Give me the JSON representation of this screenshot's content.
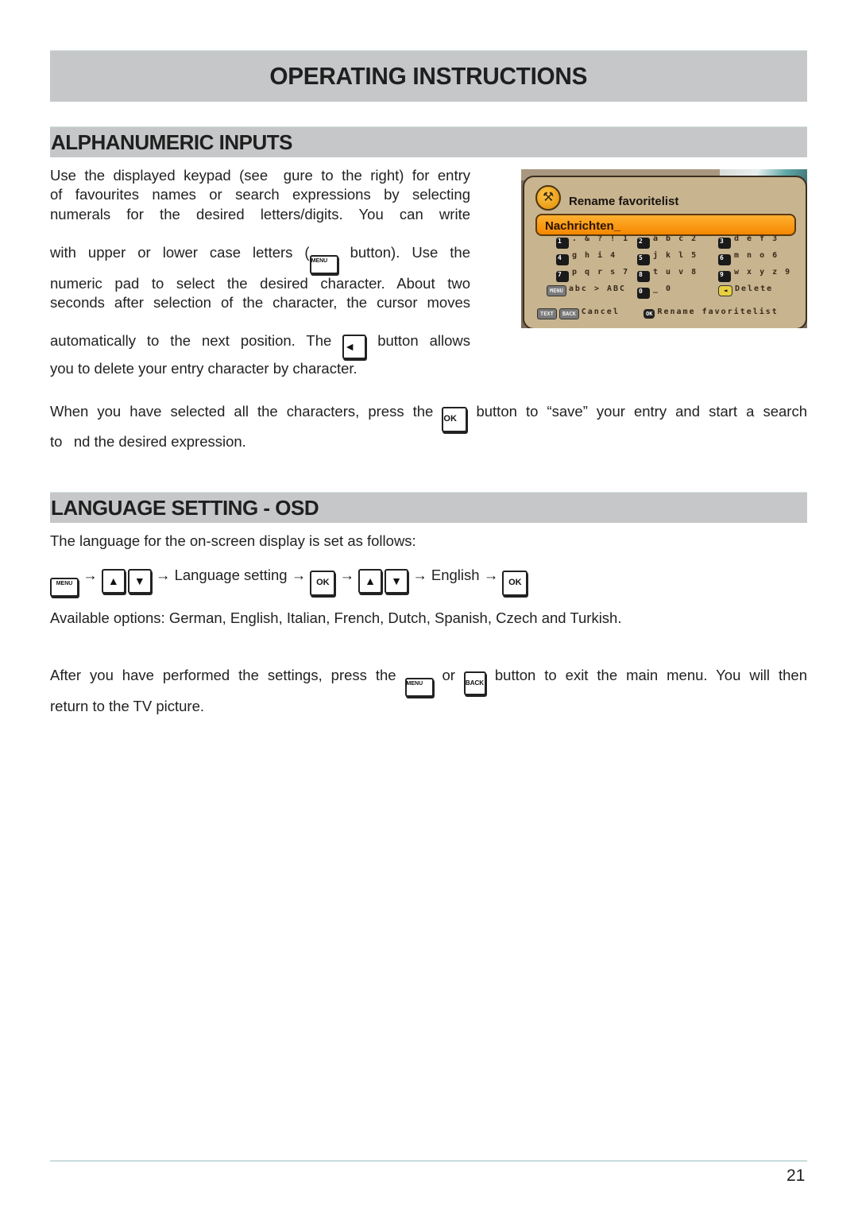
{
  "header": {
    "title": "OPERATING INSTRUCTIONS"
  },
  "sections": {
    "alphanumeric": {
      "title": "ALPHANUMERIC INPUTS",
      "para1": {
        "l1": "Use the displayed keypad (see  gure to the right) for entry",
        "l2": "of favourites names or search expressions by selecting",
        "l3": "numerals for the desired letters/digits. You can write",
        "l4a": "with upper or lower case letters (",
        "l4b": " button). Use the",
        "l5": "numeric pad to select the desired character. About two",
        "l6": "seconds after selection of the character, the cursor moves",
        "l7a": "automatically to the next position. The ",
        "l7b": " button allows",
        "l8": "you to delete your entry character by character."
      },
      "para2": {
        "l1a": "When you have selected all the characters, press the ",
        "l1b": " button to “save” your entry and start a search",
        "l2": "to  nd the desired expression."
      }
    },
    "language": {
      "title": "LANGUAGE SETTING - OSD",
      "intro": "The language for the on-screen display is set as follows:",
      "sequence": {
        "arrow": "→",
        "step1": "Language setting",
        "step2": "English"
      },
      "options": "Available options: German, English, Italian, French, Dutch, Spanish, Czech and Turkish.",
      "outro": {
        "l1a": "After you have performed the settings, press the ",
        "l1b": " or ",
        "l1c": " button to exit the main menu. You will then",
        "l2": "return to the TV picture."
      }
    }
  },
  "keys": {
    "menu": "MENU",
    "ok": "OK",
    "back": "BACK",
    "left": "◄",
    "up": "▲",
    "down": "▼"
  },
  "osd": {
    "title": "Rename favoritelist",
    "input_value": "Nachrichten_",
    "hammer_icon": "⚒",
    "keypad": [
      {
        "key": "1",
        "chars": ". & ? ! 1"
      },
      {
        "key": "2",
        "chars": "a b c 2"
      },
      {
        "key": "3",
        "chars": "d e f 3"
      },
      {
        "key": "4",
        "chars": "g h i 4"
      },
      {
        "key": "5",
        "chars": "j k l 5"
      },
      {
        "key": "6",
        "chars": "m n o 6"
      },
      {
        "key": "7",
        "chars": "p q r s 7"
      },
      {
        "key": "8",
        "chars": "t u v 8"
      },
      {
        "key": "9",
        "chars": "w x y z 9"
      },
      {
        "key": "MENU",
        "chars": "abc > ABC"
      },
      {
        "key": "0",
        "chars": "_ 0"
      },
      {
        "key": "◄",
        "chars": "Delete"
      }
    ],
    "footer": {
      "text_key": "TEXT",
      "back_key": "BACK",
      "cancel": "Cancel",
      "ok_key": "OK",
      "confirm": "Rename favoritelist"
    },
    "colors": {
      "panel": "#c8b48f",
      "input": "#f59a10"
    }
  },
  "page": {
    "number": "21"
  }
}
